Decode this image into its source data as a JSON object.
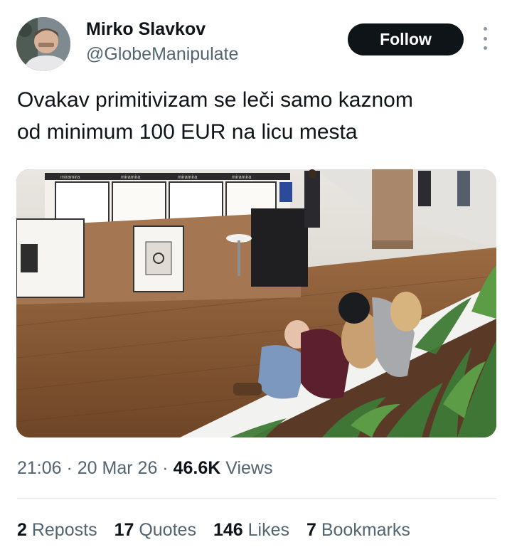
{
  "author": {
    "name": "Mirko Slavkov",
    "handle": "@GlobeManipulate"
  },
  "follow_label": "Follow",
  "more_icon": "more-vertical-icon",
  "tweet": {
    "text_line1": "Ovakav primitivizam se leči samo kaznom",
    "text_line2": "od minimum 100 EUR na licu mesta"
  },
  "media": {
    "store_signs": [
      "miramira",
      "miramira",
      "miramira",
      "miramira"
    ]
  },
  "meta": {
    "time": "21:06",
    "sep1": " · ",
    "date": "20 Mar 26",
    "sep2": " · ",
    "views_count": "46.6K",
    "views_label": " Views"
  },
  "stats": [
    {
      "count": "2",
      "label": " Reposts"
    },
    {
      "count": "17",
      "label": " Quotes"
    },
    {
      "count": "146",
      "label": " Likes"
    },
    {
      "count": "7",
      "label": " Bookmarks"
    }
  ],
  "colors": {
    "text": "#0f1419",
    "secondary": "#536471",
    "button_bg": "#0f1419",
    "divider": "#e3e7ea"
  }
}
